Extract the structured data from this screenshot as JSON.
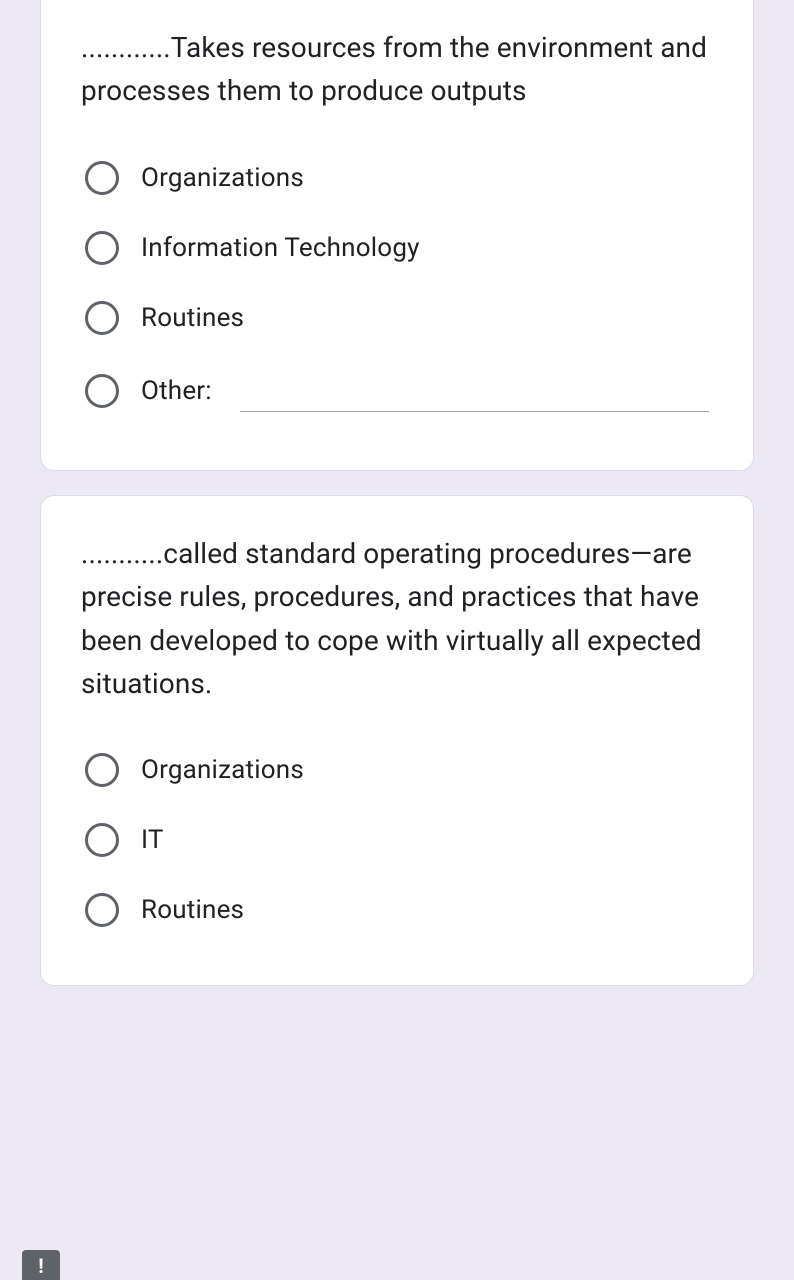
{
  "questions": [
    {
      "text": "............Takes resources from the environment and processes them to produce outputs",
      "options": [
        "Organizations",
        "Information Technology",
        "Routines"
      ],
      "other_label": "Other:"
    },
    {
      "text": "...........called standard operating procedures—are precise rules, procedures, and practices that have been developed to cope with virtually all expected situations.",
      "options": [
        "Organizations",
        "IT",
        "Routines"
      ]
    }
  ],
  "badge": "!"
}
